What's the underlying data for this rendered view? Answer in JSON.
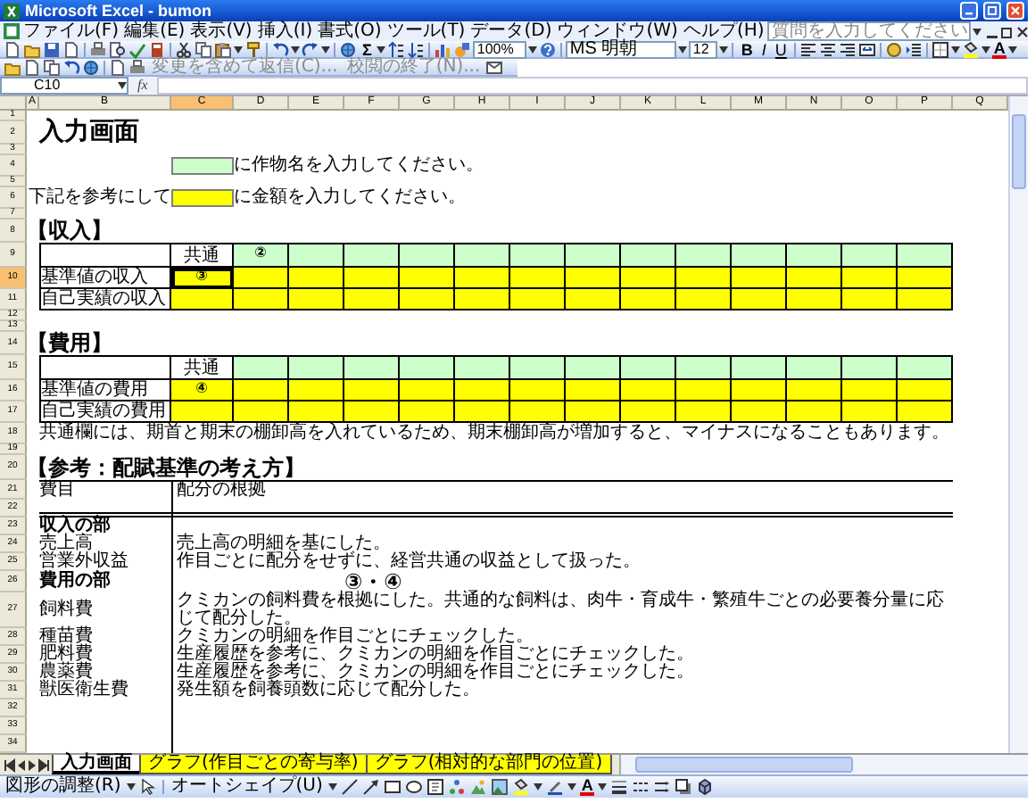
{
  "window": {
    "title": "Microsoft Excel - bumon"
  },
  "menu": [
    "ファイル(F)",
    "編集(E)",
    "表示(V)",
    "挿入(I)",
    "書式(O)",
    "ツール(T)",
    "データ(D)",
    "ウィンドウ(W)",
    "ヘルプ(H)"
  ],
  "help_search": {
    "placeholder": "質問を入力してください"
  },
  "toolbar": {
    "autosum": "Σ",
    "zoom": "100%",
    "font": "MS 明朝",
    "font_size": "12",
    "styles": [
      "B",
      "I",
      "U"
    ],
    "font_color": "A"
  },
  "review_toolbar": [
    "変更を含めて返信(C)...",
    "校閲の終了(N)..."
  ],
  "formula_bar": {
    "name_box": "C10",
    "fx": "fx"
  },
  "columns": [
    {
      "label": "A",
      "selected": false
    },
    {
      "label": "B",
      "selected": false
    },
    {
      "label": "C",
      "selected": true
    },
    {
      "label": "D",
      "selected": false
    },
    {
      "label": "E",
      "selected": false
    },
    {
      "label": "F",
      "selected": false
    },
    {
      "label": "G",
      "selected": false
    },
    {
      "label": "H",
      "selected": false
    },
    {
      "label": "I",
      "selected": false
    },
    {
      "label": "J",
      "selected": false
    },
    {
      "label": "K",
      "selected": false
    },
    {
      "label": "L",
      "selected": false
    },
    {
      "label": "M",
      "selected": false
    },
    {
      "label": "N",
      "selected": false
    },
    {
      "label": "O",
      "selected": false
    },
    {
      "label": "P",
      "selected": false
    },
    {
      "label": "Q",
      "selected": false
    }
  ],
  "row_numbers": [
    {
      "label": "1",
      "selected": false
    },
    {
      "label": "2",
      "selected": false
    },
    {
      "label": "3",
      "selected": false
    },
    {
      "label": "4",
      "selected": false
    },
    {
      "label": "5",
      "selected": false
    },
    {
      "label": "6",
      "selected": false
    },
    {
      "label": "7",
      "selected": false
    },
    {
      "label": "8",
      "selected": false
    },
    {
      "label": "9",
      "selected": false
    },
    {
      "label": "10",
      "selected": true
    },
    {
      "label": "11",
      "selected": false
    },
    {
      "label": "12",
      "selected": false
    },
    {
      "label": "13",
      "selected": false
    },
    {
      "label": "14",
      "selected": false
    },
    {
      "label": "15",
      "selected": false
    },
    {
      "label": "16",
      "selected": false
    },
    {
      "label": "17",
      "selected": false
    },
    {
      "label": "18",
      "selected": false
    },
    {
      "label": "19",
      "selected": false
    },
    {
      "label": "20",
      "selected": false
    },
    {
      "label": "21",
      "selected": false
    },
    {
      "label": "22",
      "selected": false
    },
    {
      "label": "23",
      "selected": false
    },
    {
      "label": "24",
      "selected": false
    },
    {
      "label": "25",
      "selected": false
    },
    {
      "label": "26",
      "selected": false
    },
    {
      "label": "27",
      "selected": false
    },
    {
      "label": "28",
      "selected": false
    },
    {
      "label": "29",
      "selected": false
    },
    {
      "label": "30",
      "selected": false
    },
    {
      "label": "31",
      "selected": false
    },
    {
      "label": "32",
      "selected": false
    },
    {
      "label": "33",
      "selected": false
    },
    {
      "label": "34",
      "selected": false
    }
  ],
  "sheet": {
    "title": "入力画面",
    "legend": [
      {
        "color": "#ccffcc",
        "text": "に作物名を入力してください。"
      },
      {
        "prefix": "下記を参考にして",
        "color": "#ffff00",
        "text": "に金額を入力してください。"
      }
    ],
    "income": {
      "heading": "【収入】",
      "common": "共通",
      "header_mark": "②",
      "row_mark": "③",
      "rows": [
        "基準値の収入",
        "自己実績の収入"
      ]
    },
    "cost": {
      "heading": "【費用】",
      "common": "共通",
      "row_mark": "④",
      "rows": [
        "基準値の費用",
        "自己実績の費用"
      ],
      "note": "共通欄には、期首と期末の棚卸高を入れているため、期末棚卸高が増加すると、マイナスになることもあります。"
    },
    "reference": {
      "heading": "【参考：配賦基準の考え方】",
      "columns": [
        "費目",
        "配分の根拠"
      ],
      "rows": [
        {
          "kind": "section",
          "item": "収入の部"
        },
        {
          "kind": "item",
          "item": "売上高",
          "basis": "売上高の明細を基にした。"
        },
        {
          "kind": "item",
          "item": "営業外収益",
          "basis": "作目ごとに配分をせずに、経営共通の収益として扱った。"
        },
        {
          "kind": "section",
          "item": "費用の部",
          "mark": "③・④"
        },
        {
          "kind": "item",
          "item": "飼料費",
          "basis": "クミカンの飼料費を根拠にした。共通的な飼料は、肉牛・育成牛・繁殖牛ごとの必要養分量に応じて配分した。"
        },
        {
          "kind": "item",
          "item": "種苗費",
          "basis": "クミカンの明細を作目ごとにチェックした。"
        },
        {
          "kind": "item",
          "item": "肥料費",
          "basis": "生産履歴を参考に、クミカンの明細を作目ごとにチェックした。"
        },
        {
          "kind": "item",
          "item": "農薬費",
          "basis": "生産履歴を参考に、クミカンの明細を作目ごとにチェックした。"
        },
        {
          "kind": "item",
          "item": "獣医衛生費",
          "basis": "発生額を飼養頭数に応じて配分した。"
        }
      ]
    }
  },
  "sheet_tabs": [
    {
      "label": "入力画面",
      "selected": true,
      "color": "#ffffff"
    },
    {
      "label": "グラフ(作目ごとの寄与率)",
      "selected": false,
      "color": "#ffff00"
    },
    {
      "label": "グラフ(相対的な部門の位置)",
      "selected": false,
      "color": "#ffff00"
    }
  ],
  "drawing_toolbar": {
    "menus": [
      "図形の調整(R)",
      "オートシェイプ(U)"
    ],
    "font_color": "A"
  }
}
